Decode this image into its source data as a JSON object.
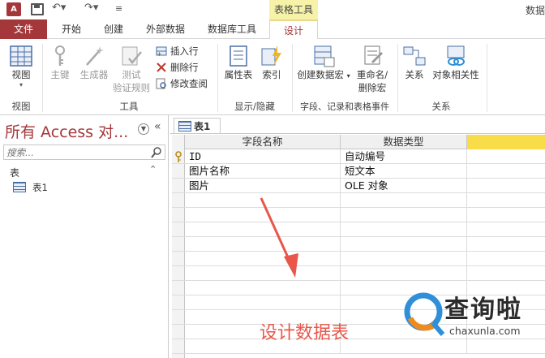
{
  "titlebar": {
    "app_icon": "A",
    "context_tab": "表格工具",
    "right_text": "数据"
  },
  "tabs": [
    {
      "label": "文件"
    },
    {
      "label": "开始"
    },
    {
      "label": "创建"
    },
    {
      "label": "外部数据"
    },
    {
      "label": "数据库工具"
    },
    {
      "label": "设计"
    }
  ],
  "ribbon": {
    "groups": {
      "views": "视图",
      "tools": "工具",
      "show_hide": "显示/隐藏",
      "field_events": "字段、记录和表格事件",
      "relationships": "关系"
    },
    "buttons": {
      "view": "视图",
      "primary_key": "主键",
      "builder": "生成器",
      "test_rules_1": "测试",
      "test_rules_2": "验证规则",
      "insert_rows": "插入行",
      "delete_rows": "删除行",
      "modify_lookups": "修改查阅",
      "property_sheet": "属性表",
      "indexes": "索引",
      "create_macro": "创建数据宏",
      "rename_macro_1": "重命名/",
      "rename_macro_2": "删除宏",
      "relationships": "关系",
      "object_dependencies": "对象相关性"
    }
  },
  "nav": {
    "title": "所有 Access 对...",
    "search_placeholder": "搜索...",
    "section": "表",
    "items": [
      {
        "label": "表1"
      }
    ]
  },
  "document": {
    "tab": "表1",
    "columns": [
      "字段名称",
      "数据类型"
    ],
    "rows": [
      {
        "field": "ID",
        "type": "自动编号",
        "primary_key": true
      },
      {
        "field": "图片名称",
        "type": "短文本"
      },
      {
        "field": "图片",
        "type": "OLE 对象"
      }
    ]
  },
  "annotation": "设计数据表",
  "watermark": {
    "brand": "查询啦",
    "domain": "chaxunla.com"
  },
  "colors": {
    "accent": "#a4373a",
    "context_tab": "#f6f3a8",
    "annotation": "#e8574a",
    "watermark_blue": "#2f8fd8",
    "watermark_orange": "#f08a1c"
  }
}
